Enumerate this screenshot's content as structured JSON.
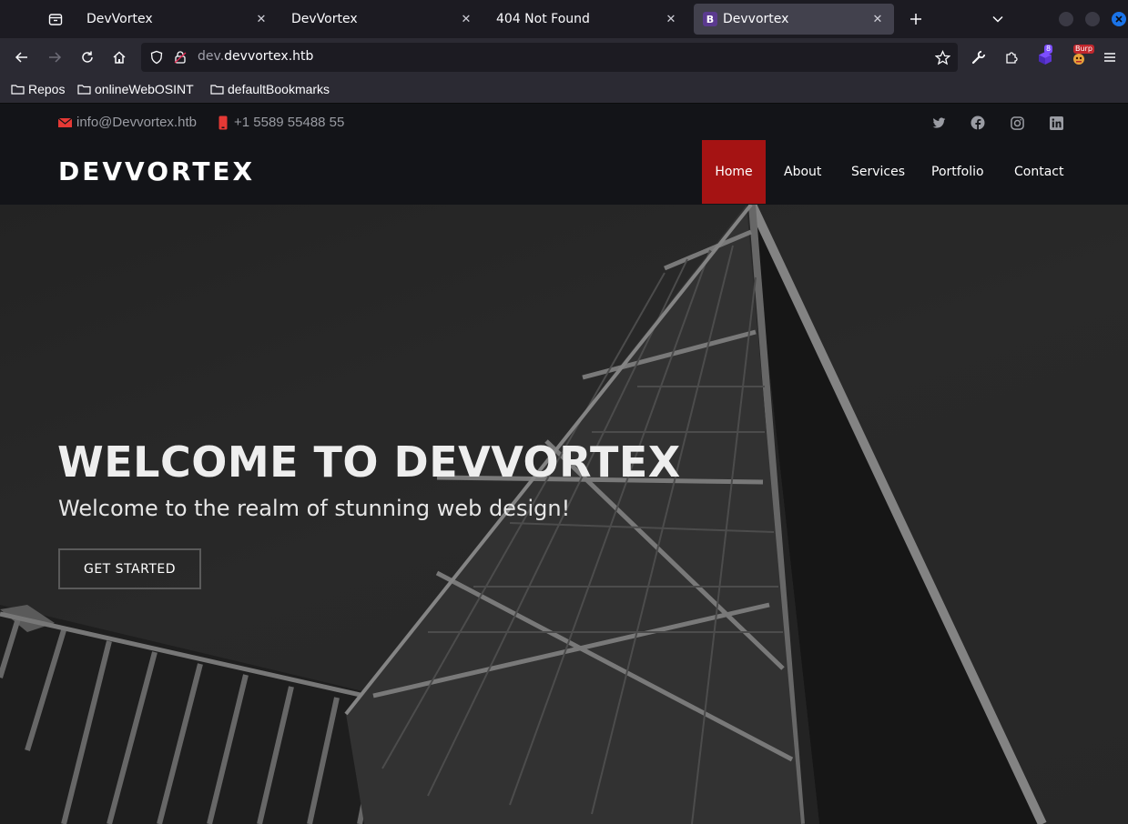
{
  "browser": {
    "tabs": [
      {
        "title": "DevVortex",
        "active": false
      },
      {
        "title": "DevVortex",
        "active": false
      },
      {
        "title": "404 Not Found",
        "active": false
      },
      {
        "title": "Devvortex",
        "active": true,
        "favicon": "B"
      }
    ],
    "url": {
      "prefix": "dev.",
      "host": "devvortex.htb"
    },
    "extension_badge": "8",
    "burp_badge": "Burp",
    "bookmarks": [
      "Repos",
      "onlineWebOSINT",
      "defaultBookmarks"
    ]
  },
  "site": {
    "email": "info@Devvortex.htb",
    "phone": "+1 5589 55488 55",
    "social": [
      "twitter-icon",
      "facebook-icon",
      "instagram-icon",
      "linkedin-icon"
    ],
    "logo": "DEVVORTEX",
    "menu": [
      {
        "label": "Home",
        "active": true
      },
      {
        "label": "About",
        "active": false
      },
      {
        "label": "Services",
        "active": false
      },
      {
        "label": "Portfolio",
        "active": false
      },
      {
        "label": "Contact",
        "active": false
      }
    ],
    "hero": {
      "title": "WELCOME TO DEVVORTEX",
      "subtitle": "Welcome to the realm of stunning web design!",
      "button": "GET STARTED"
    }
  },
  "colors": {
    "accent": "#a51313",
    "contact_icon": "#e53935",
    "window_close": "#1a73e8"
  }
}
